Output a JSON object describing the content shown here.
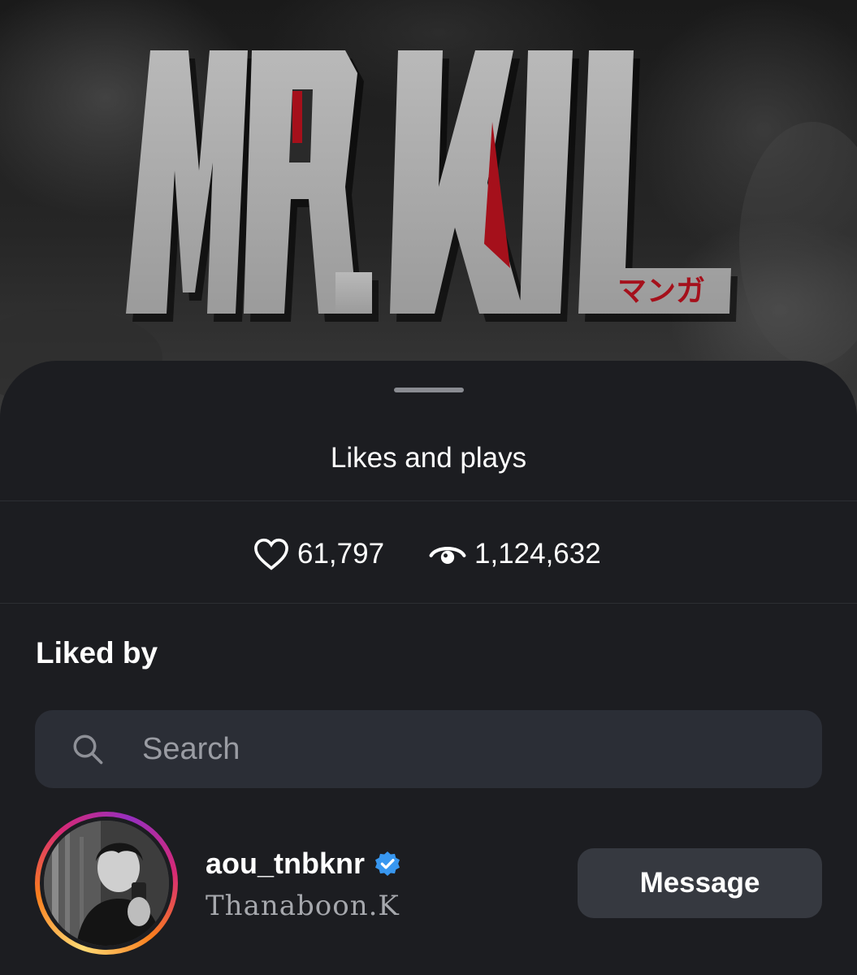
{
  "poster": {
    "title_text": "MR.KILL",
    "subtitle_text": "マンガ",
    "accent_color": "#a5101b"
  },
  "sheet": {
    "title": "Likes and plays",
    "stats": {
      "likes": {
        "icon": "heart-icon",
        "value": "61,797"
      },
      "plays": {
        "icon": "eye-icon",
        "value": "1,124,632"
      }
    },
    "liked_by": {
      "title": "Liked by",
      "search": {
        "placeholder": "Search",
        "value": ""
      },
      "users": [
        {
          "username": "aou_tnbknr",
          "verified": true,
          "full_name": "Thanaboon.K",
          "action_label": "Message"
        }
      ]
    }
  },
  "colors": {
    "sheet_background": "#1c1d21",
    "search_background": "#2b2e36",
    "button_background": "#363940",
    "verified_blue": "#3897f0"
  }
}
